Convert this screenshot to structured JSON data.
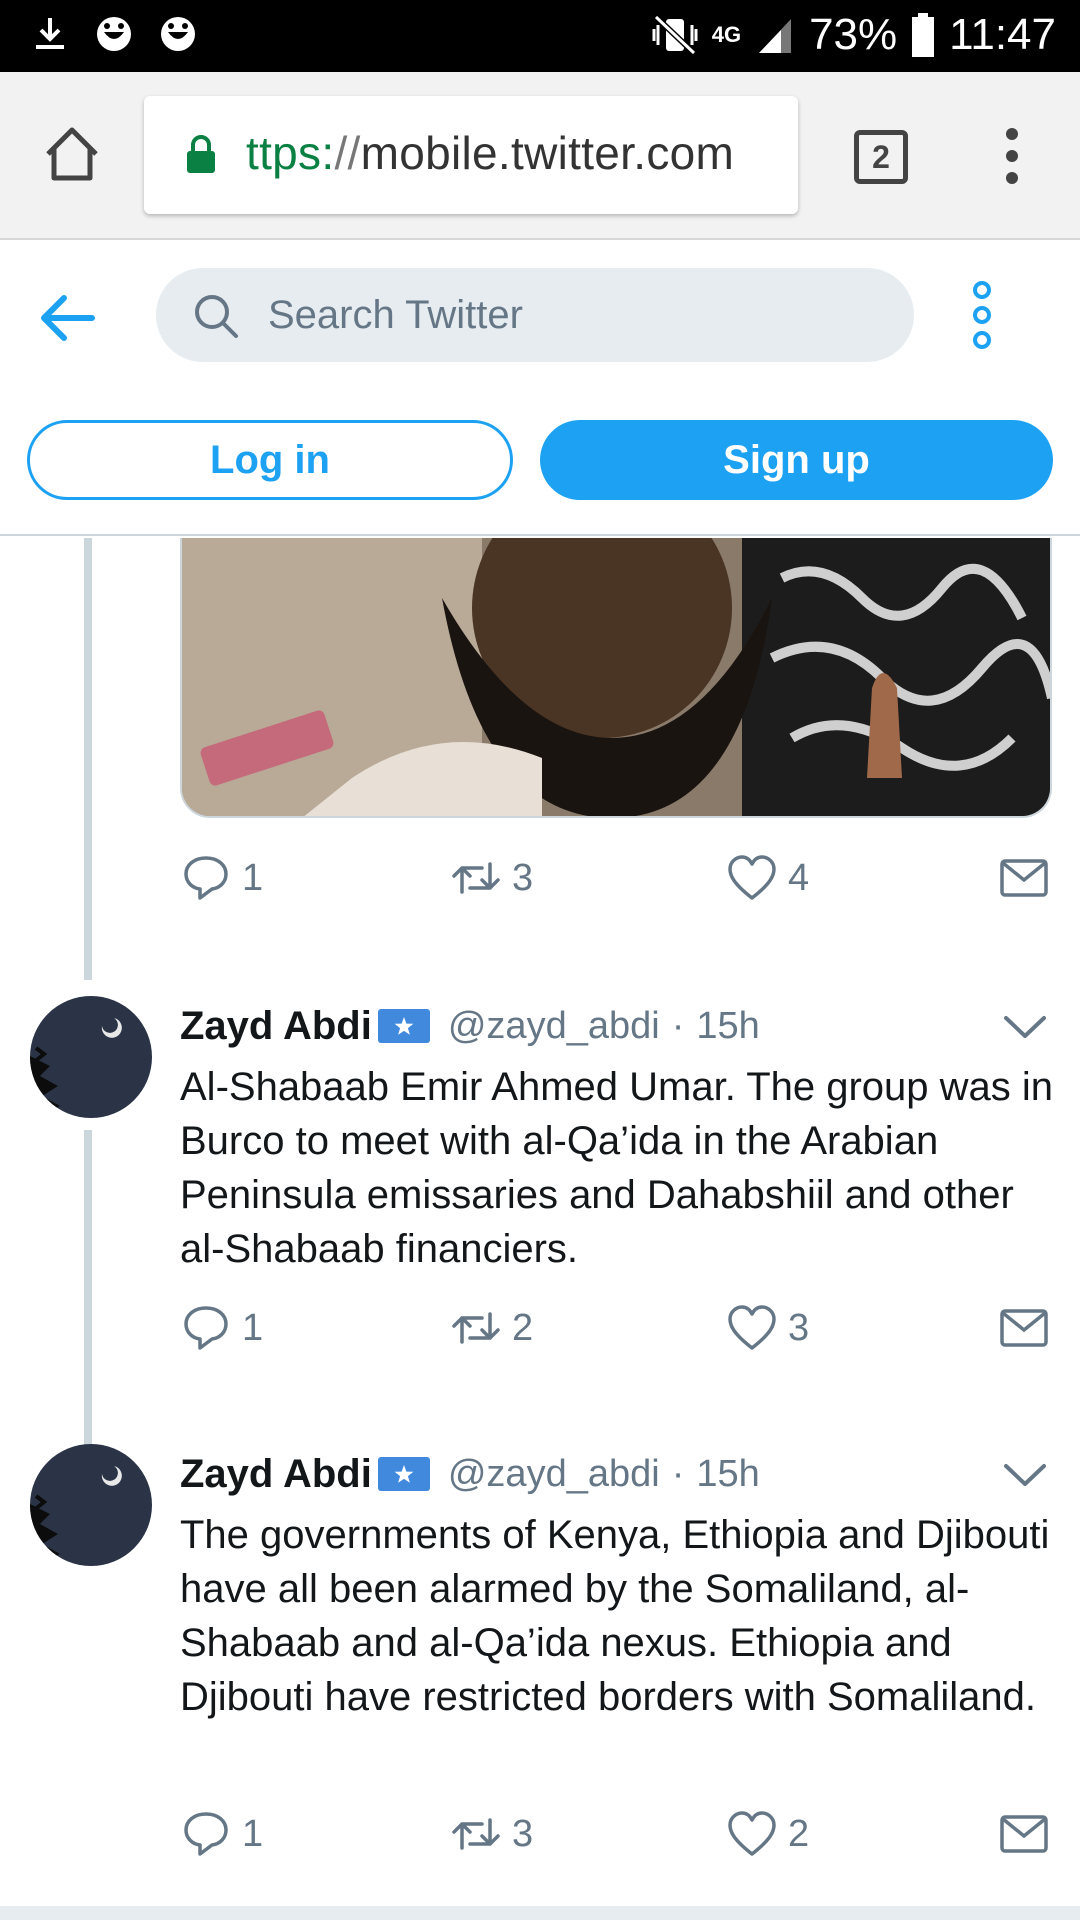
{
  "status_bar": {
    "network": "4G",
    "battery": "73%",
    "time": "11:47"
  },
  "browser": {
    "url_scheme": "ttps:",
    "url_sep": "//",
    "url_host": "mobile.twitter.com",
    "tab_count": "2"
  },
  "header": {
    "search_placeholder": "Search Twitter",
    "login_label": "Log in",
    "signup_label": "Sign up"
  },
  "tweets": [
    {
      "reply_count": "1",
      "retweet_count": "3",
      "like_count": "4"
    },
    {
      "name": "Zayd Abdi",
      "handle": "@zayd_abdi",
      "separator": "·",
      "time": "15h",
      "text": "Al-Shabaab Emir Ahmed Umar. The group was in Burco to meet with al-Qa’ida in the Arabian Peninsula emissaries and Dahabshiil and other al-Shabaab financiers.",
      "reply_count": "1",
      "retweet_count": "2",
      "like_count": "3"
    },
    {
      "name": "Zayd Abdi",
      "handle": "@zayd_abdi",
      "separator": "·",
      "time": "15h",
      "text": "The governments of Kenya, Ethiopia and Djibouti have all been alarmed by the Somaliland, al-Shabaab and al-Qa’ida nexus. Ethiopia and Djibouti have restricted borders with Somaliland.",
      "reply_count": "1",
      "retweet_count": "3",
      "like_count": "2"
    }
  ],
  "colors": {
    "twitter_blue": "#1da1f2",
    "secondary_text": "#657786",
    "search_bg": "#e6ecf0",
    "lock_green": "#0b8043",
    "flag_blue": "#4189dd"
  }
}
